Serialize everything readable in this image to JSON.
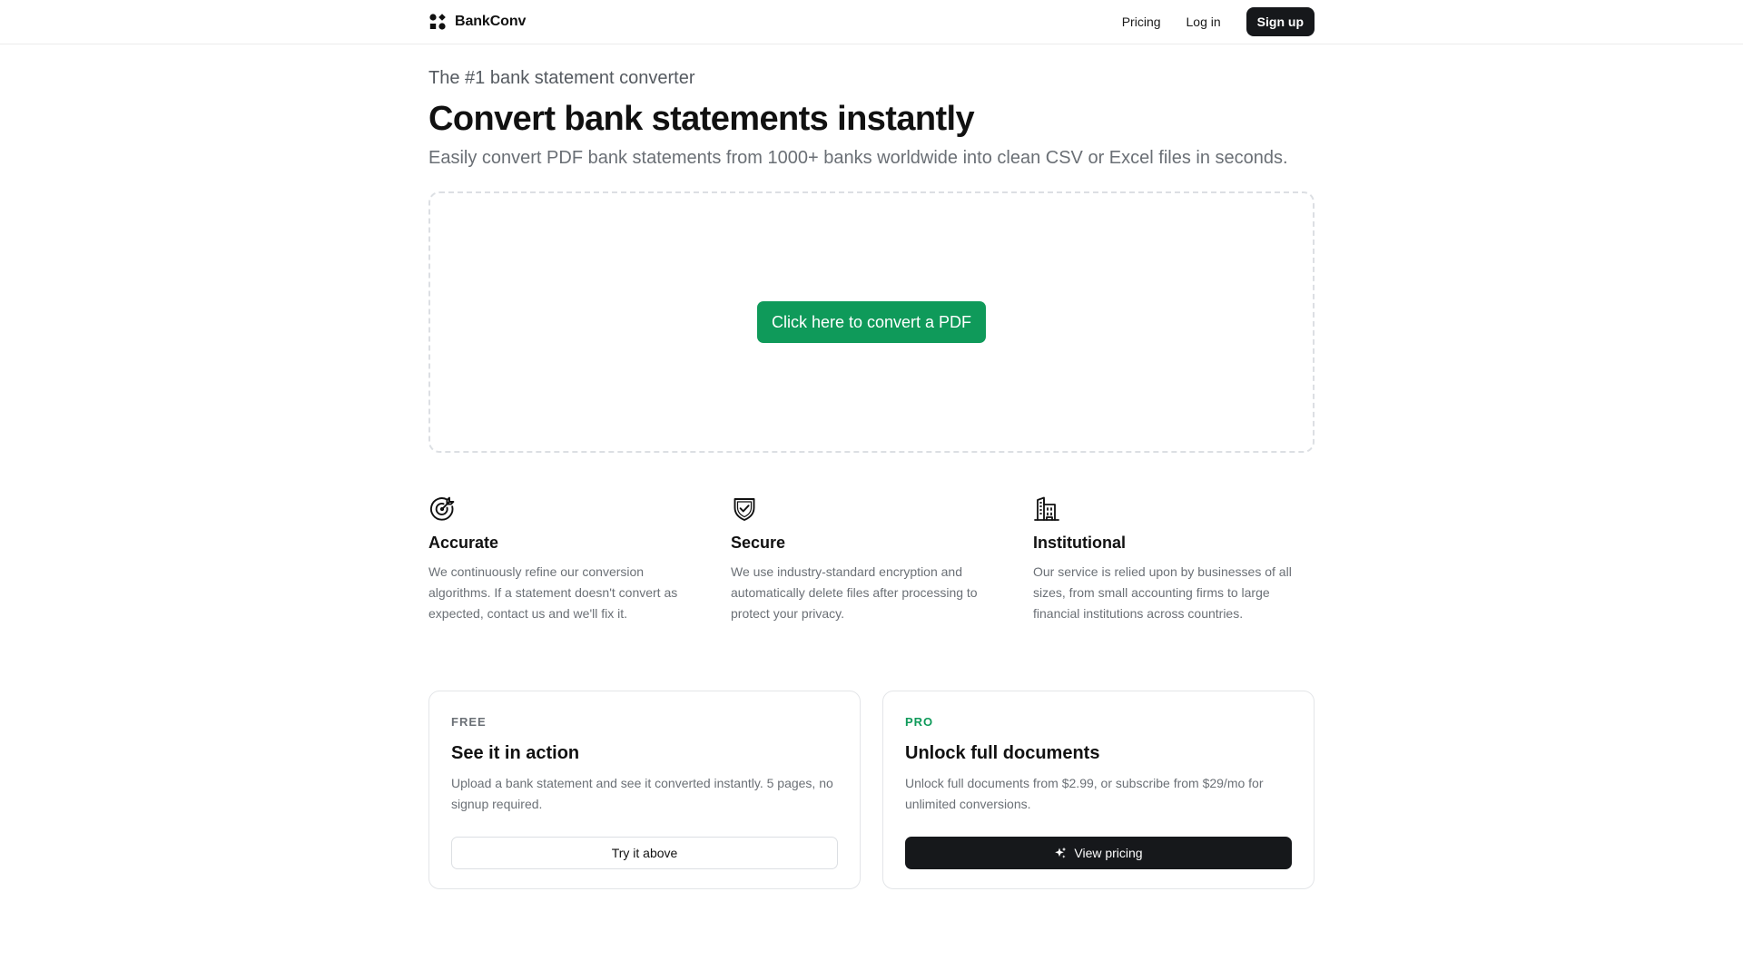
{
  "header": {
    "brand_name": "BankConv",
    "logo_icon": "bankconv-logo-icon",
    "nav": {
      "pricing": "Pricing",
      "login": "Log in",
      "signup": "Sign up"
    }
  },
  "hero": {
    "eyebrow": "The #1 bank statement converter",
    "headline": "Convert bank statements instantly",
    "subhead": "Easily convert PDF bank statements from 1000+ banks worldwide into clean CSV or Excel files in seconds."
  },
  "upload": {
    "button_label": "Click here to convert a PDF"
  },
  "features": [
    {
      "icon": "target-icon",
      "title": "Accurate",
      "description": "We continuously refine our conversion algorithms. If a statement doesn't convert as expected, contact us and we'll fix it."
    },
    {
      "icon": "shield-check-icon",
      "title": "Secure",
      "description": "We use industry-standard encryption and automatically delete files after processing to protect your privacy."
    },
    {
      "icon": "building-icon",
      "title": "Institutional",
      "description": "Our service is relied upon by businesses of all sizes, from small accounting firms to large financial institutions across countries."
    }
  ],
  "plans": {
    "free": {
      "tag": "FREE",
      "title": "See it in action",
      "description": "Upload a bank statement and see it converted instantly. 5 pages, no signup required.",
      "button": "Try it above"
    },
    "pro": {
      "tag": "PRO",
      "title": "Unlock full documents",
      "description": "Unlock full documents from $2.99, or subscribe from $29/mo for unlimited conversions.",
      "button": "View pricing",
      "button_icon": "sparkle-icon"
    }
  },
  "colors": {
    "accent_green": "#0f9a5a",
    "dark_button": "#16181b",
    "muted_text": "#6b7076",
    "border": "#e3e5e8"
  }
}
